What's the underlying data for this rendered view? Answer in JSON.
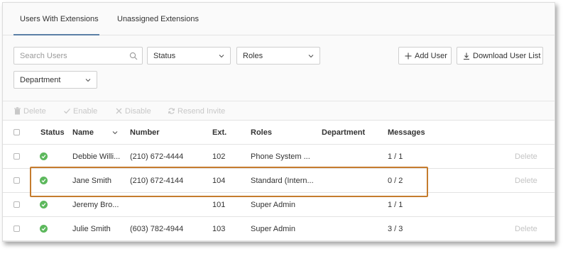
{
  "tabs": [
    {
      "label": "Users With Extensions",
      "active": true
    },
    {
      "label": "Unassigned Extensions",
      "active": false
    }
  ],
  "filters": {
    "search_placeholder": "Search Users",
    "status_label": "Status",
    "roles_label": "Roles",
    "department_label": "Department"
  },
  "buttons": {
    "add_user": "Add User",
    "download": "Download User List"
  },
  "actions": {
    "delete": "Delete",
    "enable": "Enable",
    "disable": "Disable",
    "resend": "Resend Invite"
  },
  "columns": {
    "status": "Status",
    "name": "Name",
    "number": "Number",
    "ext": "Ext.",
    "roles": "Roles",
    "department": "Department",
    "messages": "Messages"
  },
  "rows": [
    {
      "status": "active",
      "name": "Debbie Willi...",
      "number": "(210) 672-4444",
      "ext": "102",
      "roles": "Phone System ...",
      "department": "",
      "messages": "1 / 1",
      "delete": "Delete"
    },
    {
      "status": "active",
      "name": "Jane Smith",
      "number": "(210) 672-4144",
      "ext": "104",
      "roles": "Standard (Intern...",
      "department": "",
      "messages": "0 / 2",
      "delete": "Delete"
    },
    {
      "status": "active",
      "name": "Jeremy Bro...",
      "number": "",
      "ext": "101",
      "roles": "Super Admin",
      "department": "",
      "messages": "1 / 1",
      "delete": ""
    },
    {
      "status": "active",
      "name": "Julie Smith",
      "number": "(603) 782-4944",
      "ext": "103",
      "roles": "Super Admin",
      "department": "",
      "messages": "3 / 3",
      "delete": "Delete"
    }
  ],
  "colors": {
    "accent": "#5b7fa6",
    "status_active": "#5cb85c",
    "highlight": "#c57c2e"
  }
}
